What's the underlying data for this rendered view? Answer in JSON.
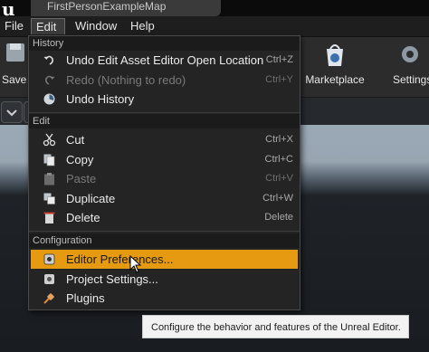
{
  "window": {
    "map_tab": "FirstPersonExampleMap"
  },
  "menubar": {
    "items": [
      "File",
      "Edit",
      "Window",
      "Help"
    ],
    "active": "Edit"
  },
  "toolbar": {
    "left_partial": "Save C",
    "marketplace": "Marketplace",
    "settings_partial": "Settings"
  },
  "edit_menu": {
    "history": {
      "header": "History",
      "items": [
        {
          "label": "Undo Edit Asset Editor Open Location",
          "shortcut": "Ctrl+Z",
          "icon": "undo-icon",
          "enabled": true
        },
        {
          "label": "Redo (Nothing to redo)",
          "shortcut": "Ctrl+Y",
          "icon": "redo-icon",
          "enabled": false
        },
        {
          "label": "Undo History",
          "shortcut": "",
          "icon": "history-icon",
          "enabled": true
        }
      ]
    },
    "edit": {
      "header": "Edit",
      "items": [
        {
          "label": "Cut",
          "shortcut": "Ctrl+X",
          "icon": "scissors-icon",
          "enabled": true
        },
        {
          "label": "Copy",
          "shortcut": "Ctrl+C",
          "icon": "copy-icon",
          "enabled": true
        },
        {
          "label": "Paste",
          "shortcut": "Ctrl+V",
          "icon": "paste-icon",
          "enabled": false
        },
        {
          "label": "Duplicate",
          "shortcut": "Ctrl+W",
          "icon": "duplicate-icon",
          "enabled": true
        },
        {
          "label": "Delete",
          "shortcut": "Delete",
          "icon": "delete-icon",
          "enabled": true
        }
      ]
    },
    "configuration": {
      "header": "Configuration",
      "items": [
        {
          "label": "Editor Preferences...",
          "icon": "gear-icon",
          "highlighted": true
        },
        {
          "label": "Project Settings...",
          "icon": "settings-icon",
          "highlighted": false
        },
        {
          "label": "Plugins",
          "icon": "plug-icon",
          "highlighted": false
        }
      ]
    }
  },
  "tooltip": {
    "text": "Configure the behavior and features of the Unreal Editor."
  },
  "colors": {
    "highlight": "#e59a12",
    "menu_bg": "#242424"
  }
}
